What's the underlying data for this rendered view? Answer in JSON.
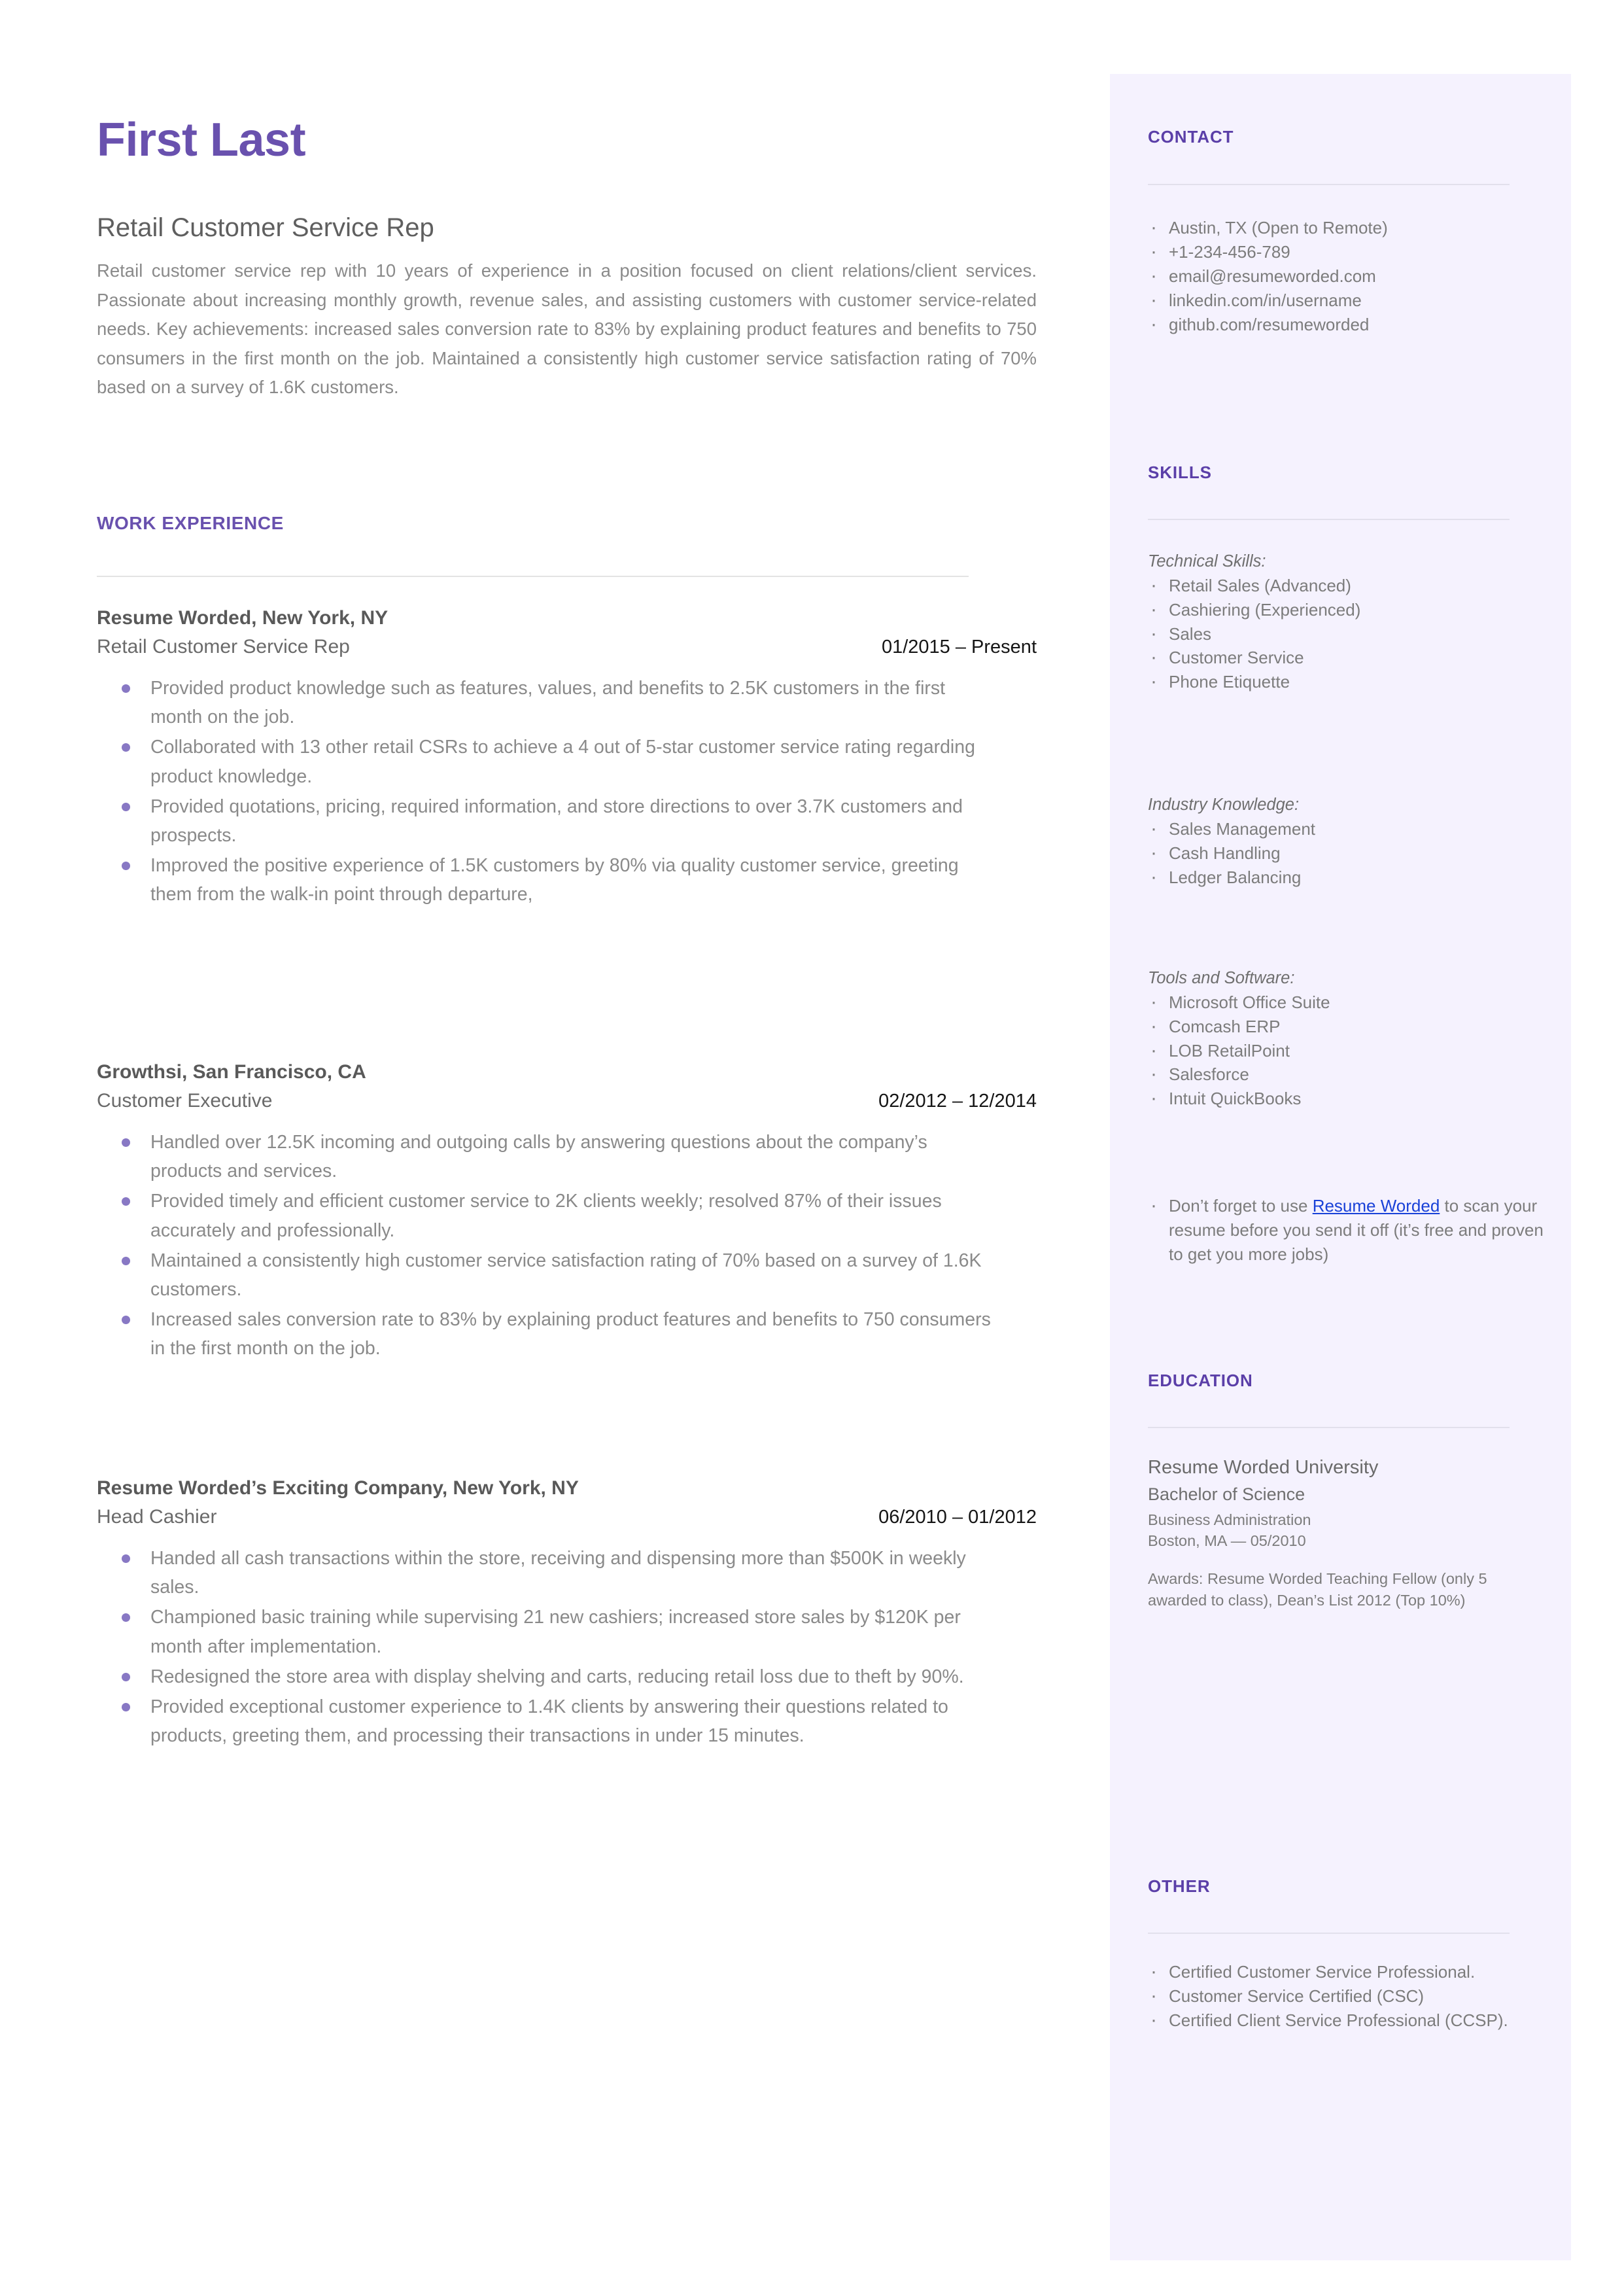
{
  "theme": {
    "accent_purple": "#6951ae",
    "heading_purple": "#5b3fa8",
    "sidebar_bg": "#f5f2fe",
    "bullet_purple": "#8878c4",
    "link_blue": "#1a42d8",
    "body_gray": "#8a8a8a"
  },
  "header": {
    "name": "First Last",
    "role": "Retail Customer Service Rep",
    "summary": "Retail customer service rep with 10 years of experience in a position focused on client relations/client services. Passionate about increasing monthly growth, revenue sales, and assisting customers with customer service-related needs. Key achievements: increased sales conversion rate to 83% by explaining product features and benefits to 750 consumers in the first month on the job. Maintained a consistently high customer service satisfaction rating of 70% based on a survey of 1.6K customers."
  },
  "work": {
    "section_title": "WORK EXPERIENCE",
    "jobs": [
      {
        "company": "Resume Worded, New York, NY",
        "title": "Retail Customer Service Rep",
        "dates": "01/2015 – Present",
        "bullets": [
          "Provided product knowledge such as features, values, and benefits to 2.5K customers in the first month on the job.",
          "Collaborated with 13 other retail CSRs to achieve a 4 out of 5-star customer service rating regarding product knowledge.",
          "Provided quotations, pricing, required information, and store directions to over 3.7K customers and prospects.",
          "Improved the positive experience of 1.5K customers by 80% via quality customer service, greeting them from the walk-in point through departure,"
        ]
      },
      {
        "company": "Growthsi, San Francisco, CA",
        "title": "Customer Executive",
        "dates": "02/2012 – 12/2014",
        "bullets": [
          "Handled over 12.5K incoming and outgoing calls by answering questions about the company’s products and services.",
          "Provided timely and efficient customer service to 2K clients weekly; resolved 87% of their issues accurately and professionally.",
          "Maintained a consistently high customer service satisfaction rating of 70% based on a survey of 1.6K customers.",
          "Increased sales conversion rate to 83% by explaining product features and benefits to 750 consumers in the first month on the job."
        ]
      },
      {
        "company": "Resume Worded’s Exciting Company, New York, NY",
        "title": "Head Cashier",
        "dates": "06/2010 – 01/2012",
        "bullets": [
          "Handed all cash transactions within the store, receiving and dispensing more than $500K in weekly sales.",
          "Championed basic training while supervising 21 new cashiers; increased store sales by $120K per month after implementation.",
          "Redesigned the store area with display shelving and carts, reducing retail loss due to theft by 90%.",
          "Provided exceptional customer experience to 1.4K clients by answering their questions related to products, greeting them, and processing their transactions in under 15 minutes."
        ]
      }
    ]
  },
  "contact": {
    "section_title": "CONTACT",
    "items": [
      "Austin, TX (Open to Remote)",
      "+1-234-456-789",
      "email@resumeworded.com",
      "linkedin.com/in/username",
      "github.com/resumeworded"
    ]
  },
  "skills": {
    "section_title": "SKILLS",
    "groups": [
      {
        "label": "Technical Skills:",
        "items": [
          "Retail Sales (Advanced)",
          "Cashiering (Experienced)",
          "Sales",
          "Customer Service",
          "Phone Etiquette"
        ]
      },
      {
        "label": "Industry Knowledge:",
        "items": [
          "Sales Management",
          "Cash Handling",
          "Ledger Balancing"
        ]
      },
      {
        "label": "Tools and Software:",
        "items": [
          "Microsoft Office Suite",
          "Comcash ERP",
          "LOB RetailPoint",
          "Salesforce",
          "Intuit QuickBooks"
        ]
      }
    ],
    "promo": {
      "before": "Don’t forget to use ",
      "link": "Resume Worded",
      "after": " to scan your resume before you send it off (it’s free and proven to get you more jobs)"
    }
  },
  "education": {
    "section_title": "EDUCATION",
    "school": "Resume Worded University",
    "degree": "Bachelor of Science",
    "major": "Business Administration",
    "location_date": "Boston, MA — 05/2010",
    "awards": "Awards: Resume Worded Teaching Fellow (only 5 awarded to class), Dean’s List 2012 (Top 10%)"
  },
  "other": {
    "section_title": "OTHER",
    "items": [
      "Certified Customer Service Professional.",
      "Customer Service Certified (CSC)",
      "Certified Client Service Professional (CCSP)."
    ]
  }
}
